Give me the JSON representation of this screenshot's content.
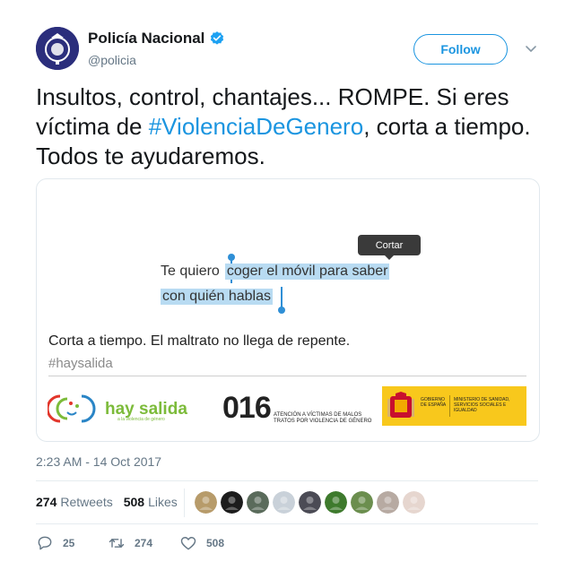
{
  "account": {
    "display_name": "Policía Nacional",
    "handle": "@policia",
    "follow_label": "Follow"
  },
  "tweet": {
    "text_before": "Insultos, control, chantajes... ROMPE. Si eres víctima de ",
    "hashtag": "#ViolenciaDeGenero",
    "text_after": ", corta a tiempo. Todos te ayudaremos."
  },
  "card": {
    "tooltip": "Cortar",
    "line1_plain": "Te quiero",
    "line1_selected": "coger el móvil para saber",
    "line2_selected": "con quién hablas",
    "heading": "Corta a tiempo. El maltrato no llega de repente.",
    "hashtag": "#haysalida",
    "hay_salida": "hay salida",
    "hay_salida_sub": "a la violencia de género",
    "number": "016",
    "number_sub": "ATENCIÓN A VÍCTIMAS DE MALOS TRATOS POR VIOLENCIA DE GÉNERO",
    "gov_left": "GOBIERNO DE ESPAÑA",
    "gov_right": "MINISTERIO DE SANIDAD, SERVICIOS SOCIALES E IGUALDAD"
  },
  "timestamp": "2:23 AM - 14 Oct 2017",
  "stats": {
    "retweets_count": "274",
    "retweets_label": "Retweets",
    "likes_count": "508",
    "likes_label": "Likes"
  },
  "likers": [
    {
      "color": "#b79b6a"
    },
    {
      "color": "#1c1c1c"
    },
    {
      "color": "#5a6b5b"
    },
    {
      "color": "#c9d1d9"
    },
    {
      "color": "#4b4b55"
    },
    {
      "color": "#3e7a2d"
    },
    {
      "color": "#6b8e4e"
    },
    {
      "color": "#b7aaa2"
    },
    {
      "color": "#e6d6cf"
    }
  ],
  "actions": {
    "reply_count": "25",
    "retweet_count": "274",
    "like_count": "508"
  },
  "colors": {
    "accent": "#1b95e0",
    "text": "#14171a",
    "muted": "#657786",
    "green": "#7cbb3a",
    "gov_yellow": "#f8c81c"
  }
}
